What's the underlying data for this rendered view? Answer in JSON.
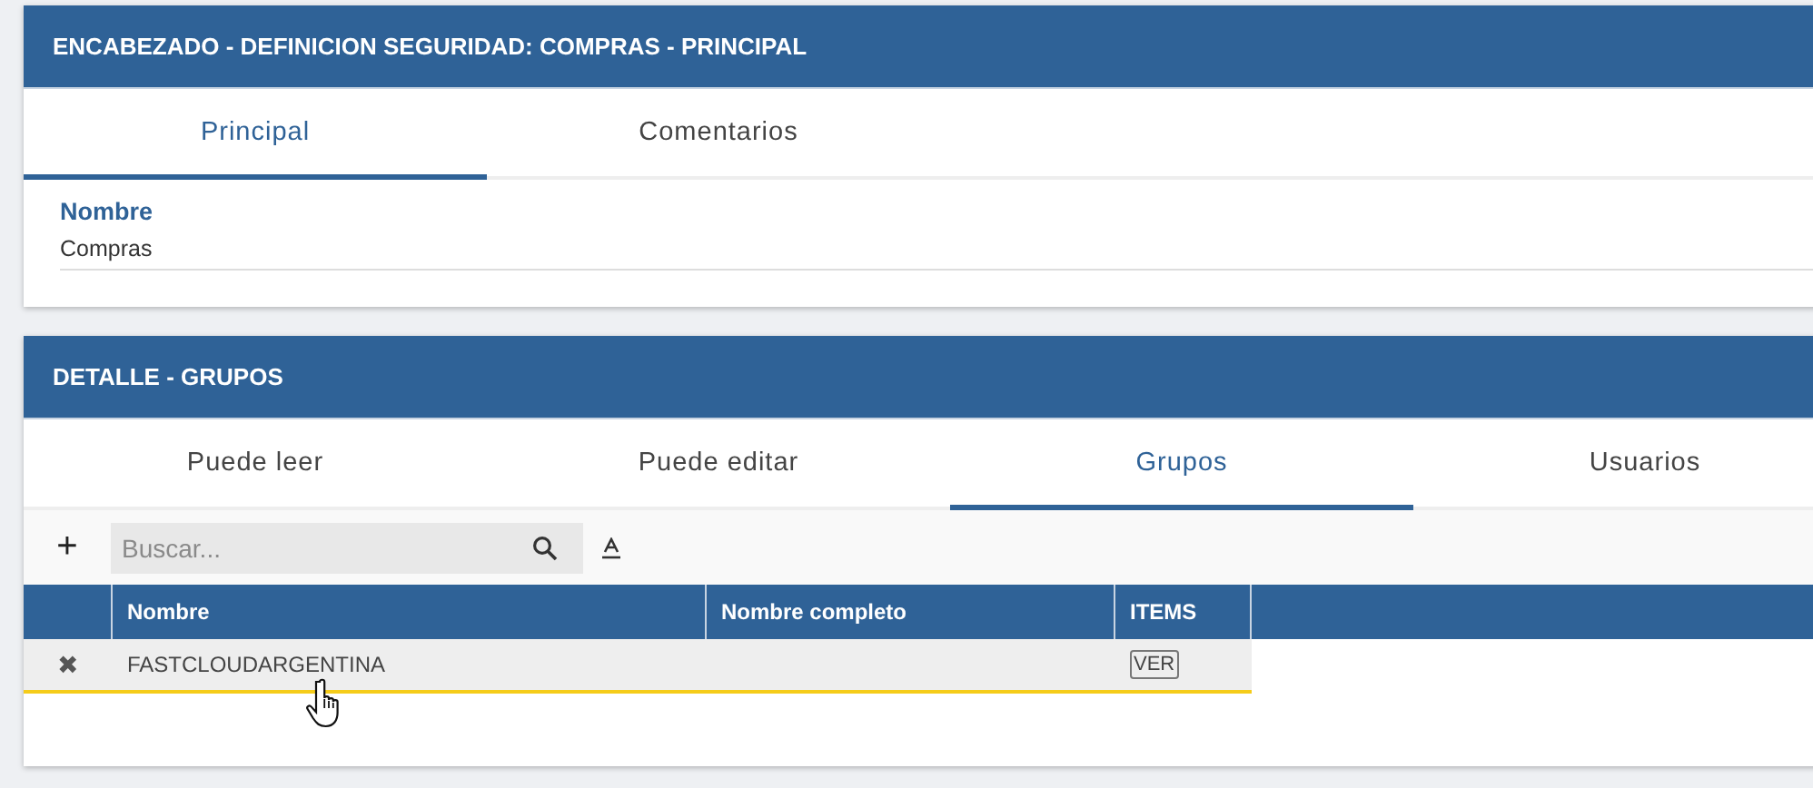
{
  "header_panel": {
    "title": "ENCABEZADO - DEFINICION SEGURIDAD: COMPRAS - PRINCIPAL",
    "tabs": [
      {
        "label": "Principal",
        "selected": true
      },
      {
        "label": "Comentarios",
        "selected": false
      }
    ],
    "field": {
      "label": "Nombre",
      "value": "Compras"
    }
  },
  "detail_panel": {
    "title": "DETALLE - GRUPOS",
    "tabs": [
      {
        "label": "Puede leer",
        "selected": false
      },
      {
        "label": "Puede editar",
        "selected": false
      },
      {
        "label": "Grupos",
        "selected": true
      },
      {
        "label": "Usuarios",
        "selected": false
      }
    ],
    "toolbar": {
      "add": "+",
      "search": {
        "placeholder": "Buscar..."
      }
    },
    "table": {
      "columns": [
        "Nombre",
        "Nombre completo",
        "ITEMS"
      ],
      "rows": [
        {
          "delete": "✖",
          "nombre": "FASTCLOUDARGENTINA",
          "nombre_completo": "",
          "items": "VER"
        }
      ]
    }
  }
}
